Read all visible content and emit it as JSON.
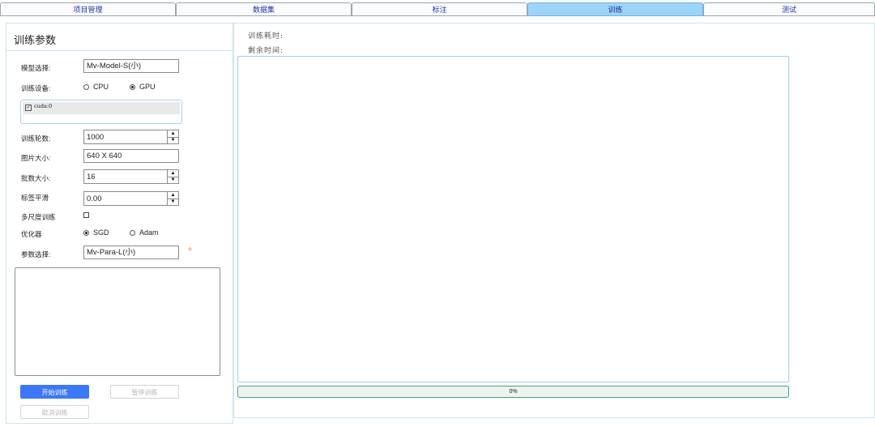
{
  "tabs": [
    {
      "label": "项目管理",
      "active": false
    },
    {
      "label": "数据集",
      "active": false
    },
    {
      "label": "标注",
      "active": false
    },
    {
      "label": "训练",
      "active": true
    },
    {
      "label": "测试",
      "active": false
    }
  ],
  "params": {
    "title": "训练参数",
    "model_label": "模型选择:",
    "model_value": "Mv-Model-S(小)",
    "device_label": "训练设备:",
    "device_options": [
      "CPU",
      "GPU"
    ],
    "device_selected": "GPU",
    "cuda_item": "cuda:0",
    "cuda_checked": true,
    "epochs_label": "训练轮数:",
    "epochs_value": "1000",
    "imgsize_label": "图片大小:",
    "imgsize_value": "640 X 640",
    "batch_label": "批数大小:",
    "batch_value": "16",
    "smooth_label": "标签平滑",
    "smooth_value": "0.00",
    "multiscale_label": "多尺度训练",
    "multiscale_checked": false,
    "optimizer_label": "优化器",
    "optimizer_options": [
      "SGD",
      "Adam"
    ],
    "optimizer_selected": "SGD",
    "paramsel_label": "参数选择:",
    "paramsel_value": "Mv-Para-L(小)",
    "required_marker": "*"
  },
  "buttons": {
    "start": "开始训练",
    "pause": "暂停训练",
    "cancel": "取消训练"
  },
  "status": {
    "elapsed_label": "训练耗时:",
    "remaining_label": "剩余时间:"
  },
  "progress": {
    "value": 0,
    "text": "0%"
  },
  "colors": {
    "accent": "#3c78f5",
    "active_tab": "#9ed4f7",
    "progress": "#3aa878",
    "required_star": "#f0a030"
  }
}
